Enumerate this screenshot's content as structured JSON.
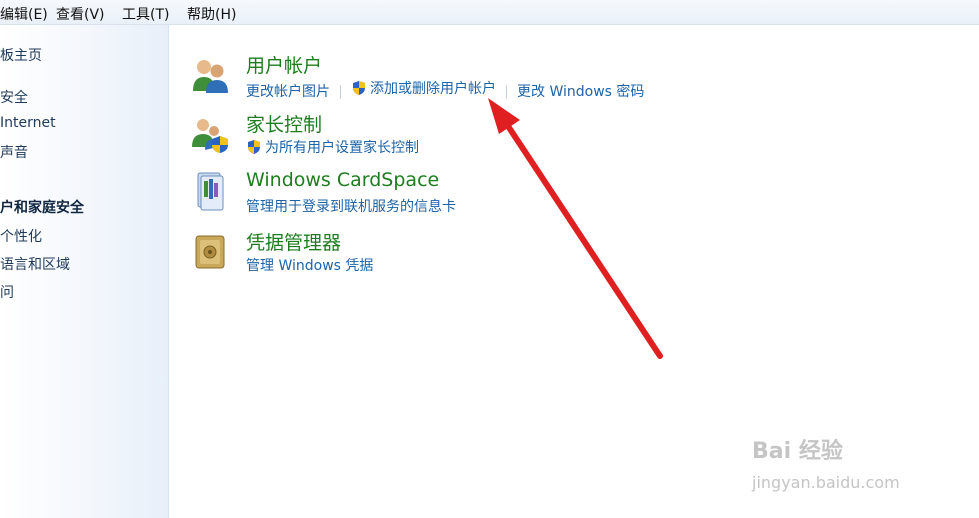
{
  "menubar": {
    "edit": "编辑(E)",
    "view": "查看(V)",
    "tools": "工具(T)",
    "help": "帮助(H)"
  },
  "sidebar": {
    "items": [
      {
        "label": "板主页"
      },
      {
        "label": "安全"
      },
      {
        "label": " Internet"
      },
      {
        "label": "声音"
      },
      {
        "label": "户和家庭安全",
        "current": true
      },
      {
        "label": "个性化"
      },
      {
        "label": "语言和区域"
      },
      {
        "label": "问"
      }
    ]
  },
  "categories": [
    {
      "title": "用户帐户",
      "icon": "user-accounts-icon",
      "links": [
        "更改帐户图片",
        "添加或删除用户帐户",
        "更改 Windows 密码"
      ]
    },
    {
      "title": "家长控制",
      "icon": "parental-controls-icon",
      "links": [
        "为所有用户设置家长控制"
      ]
    },
    {
      "title": "Windows CardSpace",
      "icon": "cardspace-icon",
      "links": [
        "管理用于登录到联机服务的信息卡"
      ]
    },
    {
      "title": "凭据管理器",
      "icon": "credential-manager-icon",
      "links": [
        "管理 Windows 凭据"
      ]
    }
  ],
  "annotation": {
    "color": "#e02020"
  },
  "watermark": {
    "brand": "Bai 经验",
    "url": "jingyan.baidu.com"
  },
  "colors": {
    "title_green": "#1e7d1e",
    "link_blue": "#1d63a8"
  }
}
